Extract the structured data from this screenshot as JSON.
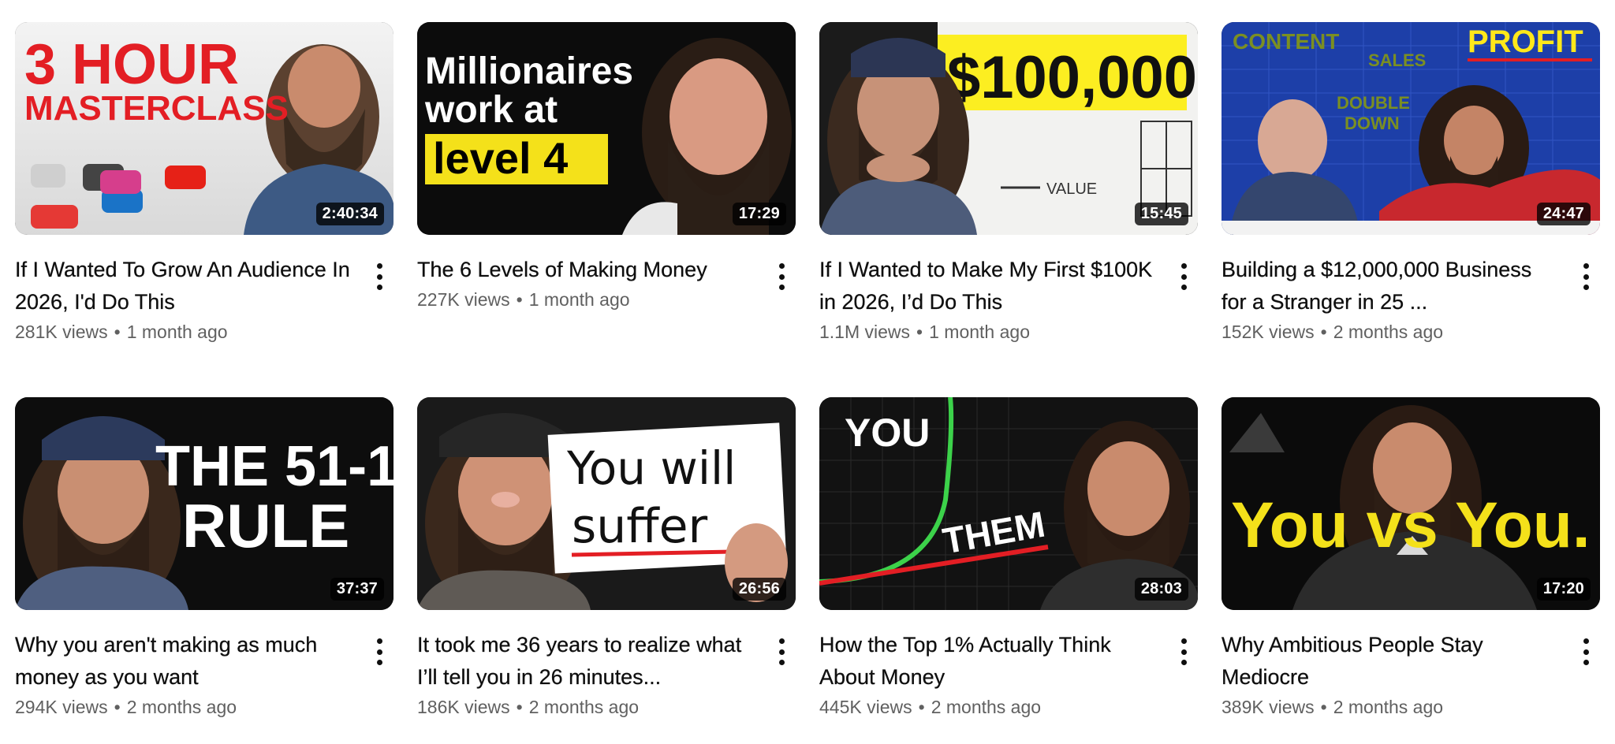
{
  "colors": {
    "title": "#0f0f0f",
    "meta": "#606060",
    "duration_bg": "#000000cc",
    "yellow": "#f4e11a",
    "red": "#e31e24"
  },
  "icons": {
    "more": "vertical-ellipsis-icon"
  },
  "videos": [
    {
      "title": "If I Wanted To Grow An Audience In 2026, I'd Do This",
      "views": "281K views",
      "age": "1 month ago",
      "duration": "2:40:34",
      "thumb_text": [
        "3 HOUR",
        "MASTERCLASS"
      ]
    },
    {
      "title": "The 6 Levels of Making Money",
      "views": "227K views",
      "age": "1 month ago",
      "duration": "17:29",
      "thumb_text": [
        "Millionaires",
        "work at",
        "level 4"
      ]
    },
    {
      "title": "If I Wanted to Make My First $100K in 2026, I’d Do This",
      "views": "1.1M views",
      "age": "1 month ago",
      "duration": "15:45",
      "thumb_text": [
        "$100,000",
        "VALUE"
      ]
    },
    {
      "title": "Building a $12,000,000 Business for a Stranger in 25 ...",
      "views": "152K views",
      "age": "2 months ago",
      "duration": "24:47",
      "thumb_text": [
        "CONTENT",
        "SALES",
        "PROFIT",
        "DOUBLE",
        "DOWN"
      ]
    },
    {
      "title": "Why you aren't making as much money as you want",
      "views": "294K views",
      "age": "2 months ago",
      "duration": "37:37",
      "thumb_text": [
        "THE 51-1",
        "RULE"
      ]
    },
    {
      "title": "It took me 36 years to realize what I’ll tell you in 26 minutes...",
      "views": "186K views",
      "age": "2 months ago",
      "duration": "26:56",
      "thumb_text": [
        "You will",
        "suffer"
      ]
    },
    {
      "title": "How the Top 1% Actually Think About Money",
      "views": "445K views",
      "age": "2 months ago",
      "duration": "28:03",
      "thumb_text": [
        "YOU",
        "THEM"
      ]
    },
    {
      "title": "Why Ambitious People Stay Mediocre",
      "views": "389K views",
      "age": "2 months ago",
      "duration": "17:20",
      "thumb_text": [
        "You vs You."
      ]
    }
  ],
  "separator": "•"
}
